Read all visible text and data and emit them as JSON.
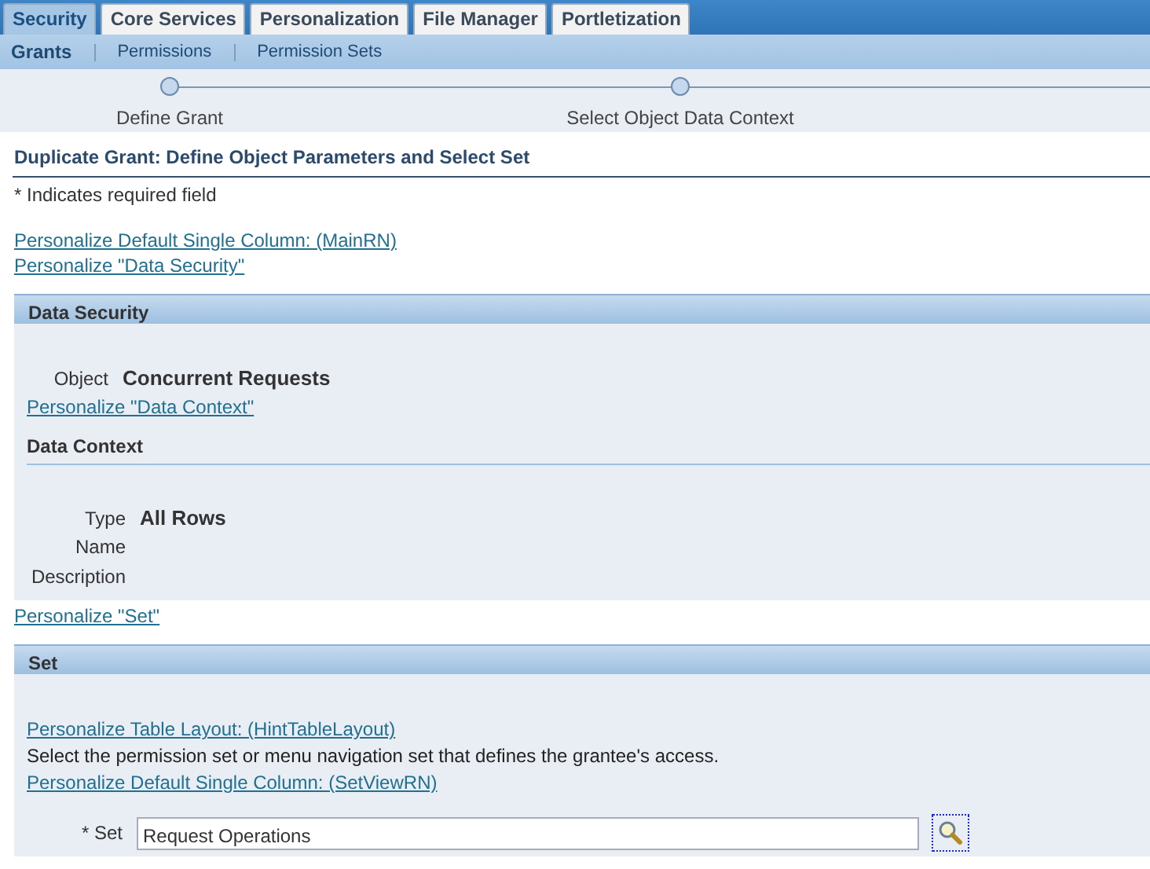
{
  "tabs": [
    {
      "label": "Security",
      "selected": true
    },
    {
      "label": "Core Services",
      "selected": false
    },
    {
      "label": "Personalization",
      "selected": false
    },
    {
      "label": "File Manager",
      "selected": false
    },
    {
      "label": "Portletization",
      "selected": false
    }
  ],
  "subtabs": [
    {
      "label": "Grants",
      "selected": true
    },
    {
      "label": "Permissions",
      "selected": false
    },
    {
      "label": "Permission Sets",
      "selected": false
    }
  ],
  "train": [
    "Define Grant",
    "Select Object Data Context"
  ],
  "page_title": "Duplicate Grant: Define Object Parameters and Select Set",
  "required_note": "* Indicates required field",
  "top_links": [
    "Personalize Default Single Column: (MainRN)",
    "Personalize \"Data Security\""
  ],
  "data_security": {
    "title": "Data Security",
    "object_label": "Object",
    "object_value": "Concurrent Requests",
    "link": "Personalize \"Data Context\"",
    "data_context": {
      "title": "Data Context",
      "fields": [
        {
          "label": "Type",
          "value": "All Rows"
        },
        {
          "label": "Name"
        },
        {
          "label": "Description"
        }
      ]
    }
  },
  "set_link": "Personalize \"Set\"",
  "set": {
    "title": "Set",
    "link1": "Personalize Table Layout: (HintTableLayout)",
    "hint": "Select the permission set or menu navigation set that defines the grantee's access.",
    "link2": "Personalize Default Single Column: (SetViewRN)",
    "field_label": "* Set",
    "field_value": "Request Operations"
  }
}
